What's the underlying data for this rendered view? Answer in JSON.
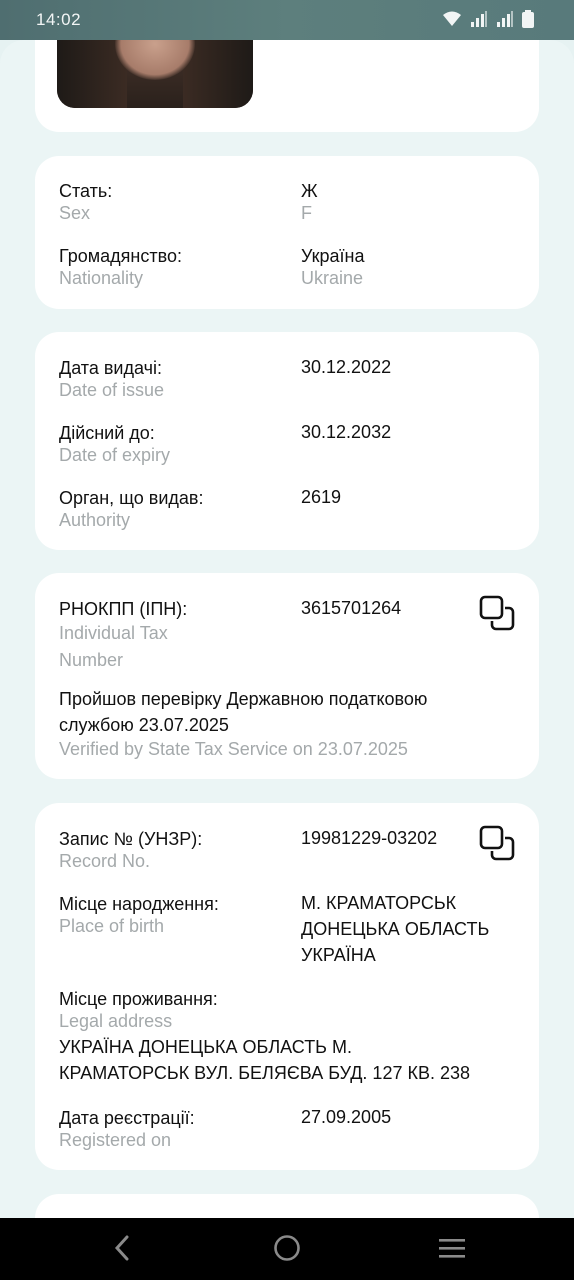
{
  "status_bar": {
    "time": "14:02"
  },
  "sex": {
    "label": "Стать:",
    "sub": "Sex",
    "value": "Ж",
    "value_sub": "F"
  },
  "nationality": {
    "label": "Громадянство:",
    "sub": "Nationality",
    "value": "Україна",
    "value_sub": "Ukraine"
  },
  "issue_date": {
    "label": "Дата видачі:",
    "sub": "Date of issue",
    "value": "30.12.2022"
  },
  "expiry_date": {
    "label": "Дійсний до:",
    "sub": "Date of expiry",
    "value": "30.12.2032"
  },
  "authority": {
    "label": "Орган, що видав:",
    "sub": "Authority",
    "value": "2619"
  },
  "tax": {
    "label": "РНОКПП (ІПН):",
    "sub_line1": "Individual Tax",
    "sub_line2": "Number",
    "value": "3615701264",
    "verified_line1": "Пройшов перевірку Державною податковою",
    "verified_line2": "службою 23.07.2025",
    "verified_en": "Verified by State Tax Service on 23.07.2025"
  },
  "record": {
    "label": "Запис № (УНЗР):",
    "sub": "Record No.",
    "value": "19981229-03202"
  },
  "birth_place": {
    "label": "Місце народження:",
    "sub": "Place of birth",
    "value_line1": "М. КРАМАТОРСЬК",
    "value_line2": "ДОНЕЦЬКА ОБЛАСТЬ",
    "value_line3": "УКРАЇНА"
  },
  "address": {
    "label": "Місце проживання:",
    "sub": "Legal address",
    "value_line1": "УКРАЇНА ДОНЕЦЬКА ОБЛАСТЬ М.",
    "value_line2": "КРАМАТОРСЬК ВУЛ. БЕЛЯЄВА БУД. 127 КВ. 238"
  },
  "registration": {
    "label": "Дата реєстрації:",
    "sub": "Registered on",
    "value": "27.09.2005"
  },
  "icons": {
    "copy": "copy-icon",
    "back": "back-icon",
    "home": "home-icon",
    "menu": "recent-apps-icon"
  }
}
